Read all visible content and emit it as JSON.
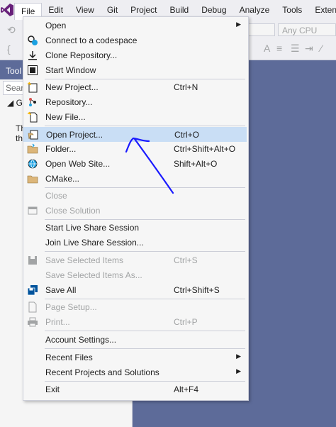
{
  "menubar": {
    "items": [
      "File",
      "Edit",
      "View",
      "Git",
      "Project",
      "Build",
      "Debug",
      "Analyze",
      "Tools",
      "Extensi"
    ]
  },
  "toolbar": {
    "platform_select": "Any CPU",
    "brace_glyph": "{"
  },
  "toolbox": {
    "header": "Tool",
    "search_placeholder": "Sear",
    "group": "◢ G",
    "body_line1": "Th",
    "body_line2": "th"
  },
  "file_menu": {
    "items": [
      {
        "label": "Open",
        "shortcut": "",
        "submenu": true,
        "disabled": false,
        "icon": ""
      },
      {
        "label": "Connect to a codespace",
        "shortcut": "",
        "submenu": false,
        "disabled": false,
        "icon": "codespace-icon"
      },
      {
        "label": "Clone Repository...",
        "shortcut": "",
        "submenu": false,
        "disabled": false,
        "icon": "clone-icon"
      },
      {
        "label": "Start Window",
        "shortcut": "",
        "submenu": false,
        "disabled": false,
        "icon": "start-window-icon"
      },
      {
        "label": "New Project...",
        "shortcut": "Ctrl+N",
        "submenu": false,
        "disabled": false,
        "icon": "new-project-icon"
      },
      {
        "label": "Repository...",
        "shortcut": "",
        "submenu": false,
        "disabled": false,
        "icon": "repository-icon"
      },
      {
        "label": "New File...",
        "shortcut": "",
        "submenu": false,
        "disabled": false,
        "icon": "new-file-icon"
      },
      {
        "label": "Open Project...",
        "shortcut": "Ctrl+O",
        "submenu": false,
        "disabled": false,
        "icon": "open-project-icon"
      },
      {
        "label": "Folder...",
        "shortcut": "Ctrl+Shift+Alt+O",
        "submenu": false,
        "disabled": false,
        "icon": "folder-icon"
      },
      {
        "label": "Open Web Site...",
        "shortcut": "Shift+Alt+O",
        "submenu": false,
        "disabled": false,
        "icon": "web-site-icon"
      },
      {
        "label": "CMake...",
        "shortcut": "",
        "submenu": false,
        "disabled": false,
        "icon": "cmake-icon"
      },
      {
        "label": "Close",
        "shortcut": "",
        "submenu": false,
        "disabled": true,
        "icon": ""
      },
      {
        "label": "Close Solution",
        "shortcut": "",
        "submenu": false,
        "disabled": true,
        "icon": "close-solution-icon"
      },
      {
        "label": "Start Live Share Session",
        "shortcut": "",
        "submenu": false,
        "disabled": false,
        "icon": ""
      },
      {
        "label": "Join Live Share Session...",
        "shortcut": "",
        "submenu": false,
        "disabled": false,
        "icon": ""
      },
      {
        "label": "Save Selected Items",
        "shortcut": "Ctrl+S",
        "submenu": false,
        "disabled": true,
        "icon": "save-icon"
      },
      {
        "label": "Save Selected Items As...",
        "shortcut": "",
        "submenu": false,
        "disabled": true,
        "icon": ""
      },
      {
        "label": "Save All",
        "shortcut": "Ctrl+Shift+S",
        "submenu": false,
        "disabled": false,
        "icon": "save-all-icon"
      },
      {
        "label": "Page Setup...",
        "shortcut": "",
        "submenu": false,
        "disabled": true,
        "icon": "page-setup-icon"
      },
      {
        "label": "Print...",
        "shortcut": "Ctrl+P",
        "submenu": false,
        "disabled": true,
        "icon": "print-icon"
      },
      {
        "label": "Account Settings...",
        "shortcut": "",
        "submenu": false,
        "disabled": false,
        "icon": ""
      },
      {
        "label": "Recent Files",
        "shortcut": "",
        "submenu": true,
        "disabled": false,
        "icon": ""
      },
      {
        "label": "Recent Projects and Solutions",
        "shortcut": "",
        "submenu": true,
        "disabled": false,
        "icon": ""
      },
      {
        "label": "Exit",
        "shortcut": "Alt+F4",
        "submenu": false,
        "disabled": false,
        "icon": ""
      }
    ],
    "highlighted": "Open Project..."
  },
  "colors": {
    "accent_purple": "#68217a",
    "highlight": "#c9def5",
    "annotation_ink": "#1a1aff",
    "workspace": "#5d6b99"
  }
}
